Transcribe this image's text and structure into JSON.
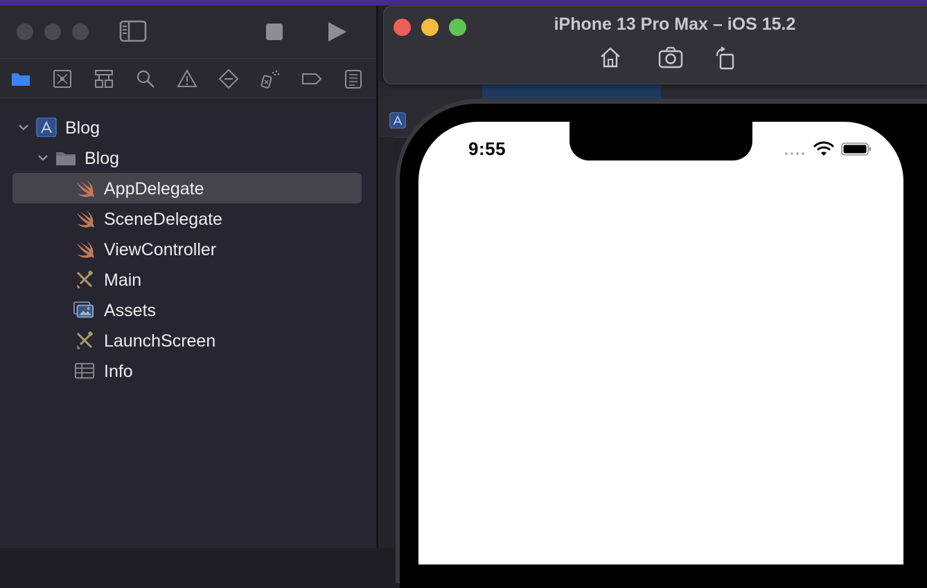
{
  "xcode": {
    "toolbar": {
      "traffic_lights": [
        "close",
        "minimize",
        "zoom"
      ],
      "sidebar_toggle_icon": "sidebar-icon",
      "stop_icon": "stop-icon",
      "run_icon": "play-icon"
    },
    "navigator_tabs": [
      {
        "icon": "folder-icon",
        "active": true
      },
      {
        "icon": "source-control-icon",
        "active": false
      },
      {
        "icon": "hierarchy-icon",
        "active": false
      },
      {
        "icon": "search-icon",
        "active": false
      },
      {
        "icon": "warning-icon",
        "active": false
      },
      {
        "icon": "test-diamond-icon",
        "active": false
      },
      {
        "icon": "debug-spray-icon",
        "active": false
      },
      {
        "icon": "breakpoint-icon",
        "active": false
      },
      {
        "icon": "report-icon",
        "active": false
      }
    ],
    "project_tree": [
      {
        "label": "Blog",
        "kind": "project",
        "depth": 0,
        "expanded": true
      },
      {
        "label": "Blog",
        "kind": "folder",
        "depth": 1,
        "expanded": true
      },
      {
        "label": "AppDelegate",
        "kind": "swift",
        "depth": 2,
        "selected": true
      },
      {
        "label": "SceneDelegate",
        "kind": "swift",
        "depth": 2
      },
      {
        "label": "ViewController",
        "kind": "swift",
        "depth": 2
      },
      {
        "label": "Main",
        "kind": "storyboard",
        "depth": 2
      },
      {
        "label": "Assets",
        "kind": "assets",
        "depth": 2
      },
      {
        "label": "LaunchScreen",
        "kind": "storyboard",
        "depth": 2
      },
      {
        "label": "Info",
        "kind": "plist",
        "depth": 2
      }
    ]
  },
  "simulator": {
    "title": "iPhone 13 Pro Max – iOS 15.2",
    "buttons": [
      "home-icon",
      "screenshot-icon",
      "rotate-icon"
    ],
    "status_bar": {
      "time": "9:55",
      "wifi": "wifi-icon",
      "battery": "battery-icon"
    }
  },
  "colors": {
    "navigator_bg": "#27252f",
    "selection": "#45434c",
    "accent_blue": "#3b82f6",
    "swift_orange": "#c0795a",
    "close": "#ee5f58",
    "minimize": "#f3bc3f",
    "zoom": "#5fc552"
  }
}
